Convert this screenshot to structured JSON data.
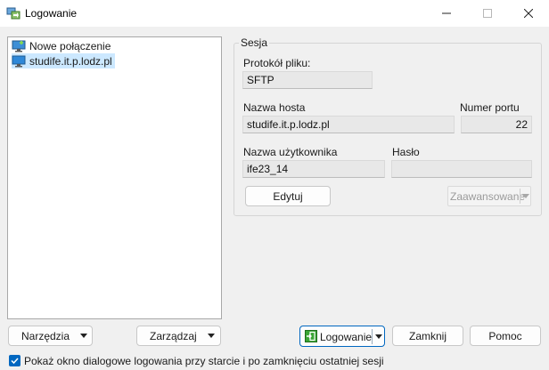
{
  "window": {
    "title": "Logowanie",
    "app_icon": "winscp-icon",
    "controls": [
      "minimize-icon",
      "maximize-icon",
      "close-icon"
    ]
  },
  "sessions": {
    "items": [
      {
        "label": "Nowe połączenie",
        "icon": "new-site-monitor-icon",
        "selected": false
      },
      {
        "label": "studife.it.p.lodz.pl",
        "icon": "site-monitor-icon",
        "selected": true
      }
    ]
  },
  "session_panel": {
    "title": "Sesja",
    "protocol_label": "Protokół pliku:",
    "protocol_value": "SFTP",
    "host_label": "Nazwa hosta",
    "host_value": "studife.it.p.lodz.pl",
    "port_label": "Numer portu",
    "port_value": "22",
    "user_label": "Nazwa użytkownika",
    "user_value": "ife23_14",
    "password_label": "Hasło",
    "password_value": "",
    "edit_button": "Edytuj",
    "advanced_button": "Zaawansowane"
  },
  "footer": {
    "tools_button": "Narzędzia",
    "manage_button": "Zarządzaj",
    "login_button": "Logowanie",
    "close_button": "Zamknij",
    "help_button": "Pomoc",
    "show_on_startup_label": "Pokaż okno dialogowe logowania przy starcie i po zamknięciu ostatniej sesji",
    "show_on_startup_checked": true
  },
  "colors": {
    "accent": "#0067c0",
    "selection": "#cce8ff",
    "field_bg": "#e8e8e8",
    "dialog_bg": "#f0f0f0"
  }
}
